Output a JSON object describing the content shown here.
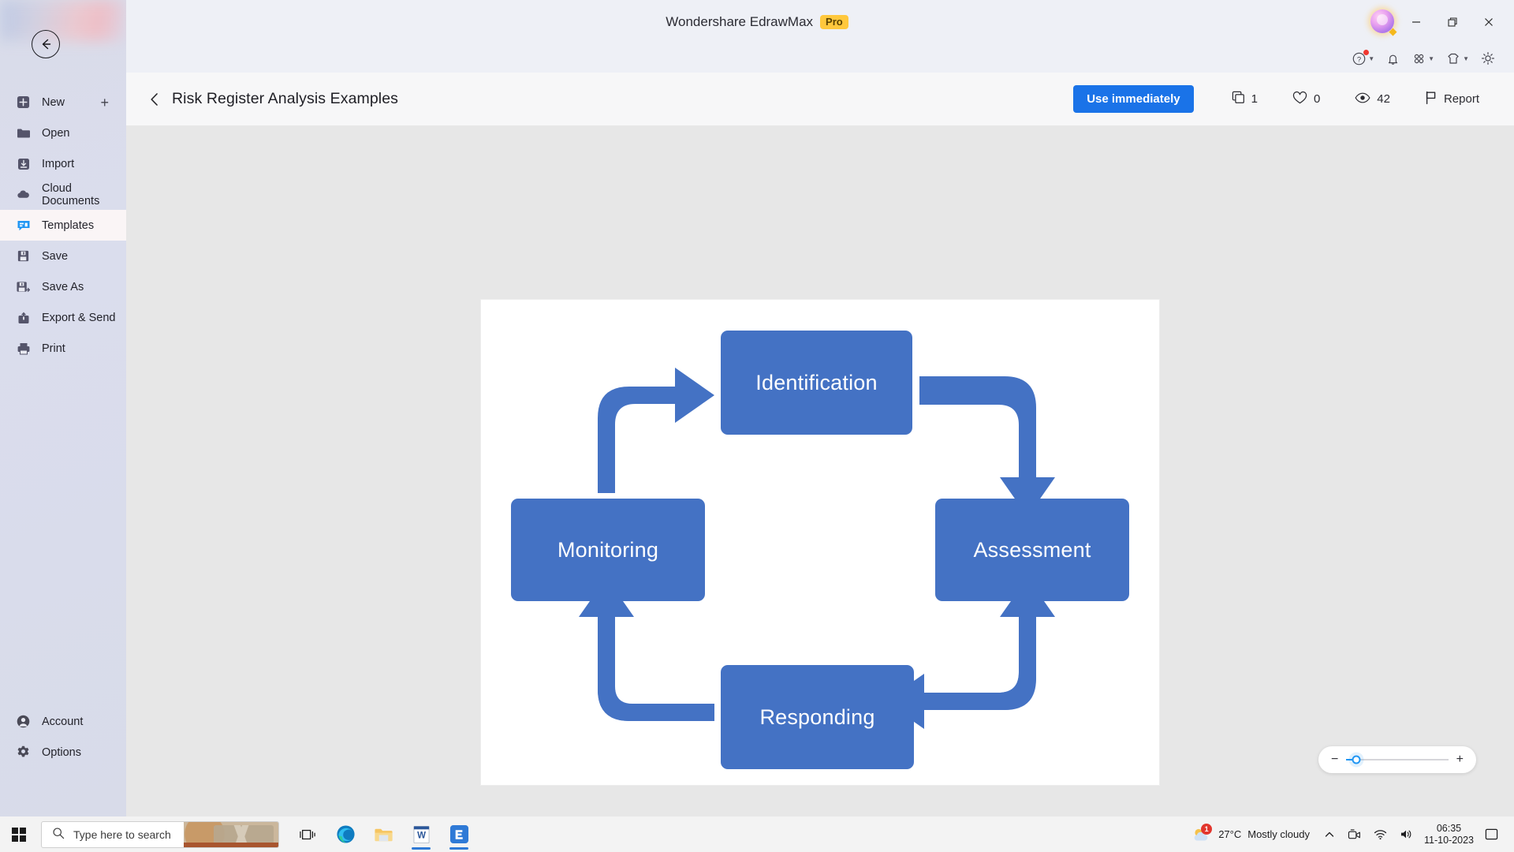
{
  "titlebar": {
    "app_title": "Wondershare EdrawMax",
    "pro_badge": "Pro",
    "minimize_label": "Minimize",
    "maximize_label": "Restore",
    "close_label": "Close",
    "avatar_name": "user-avatar"
  },
  "iconrow": {
    "items": [
      {
        "name": "help-icon",
        "label": "Help",
        "has_dot": true,
        "has_chevron": true
      },
      {
        "name": "bell-icon",
        "label": "Notifications",
        "has_dot": false,
        "has_chevron": false
      },
      {
        "name": "apps-grid-icon",
        "label": "Apps",
        "has_dot": false,
        "has_chevron": true
      },
      {
        "name": "theme-shirt-icon",
        "label": "Theme",
        "has_dot": false,
        "has_chevron": true
      },
      {
        "name": "gear-icon",
        "label": "Settings",
        "has_dot": false,
        "has_chevron": false
      }
    ]
  },
  "sidebar": {
    "back_label": "Back",
    "new_plus_label": "+",
    "items": [
      {
        "label": "New",
        "icon": "new-icon",
        "active": false,
        "has_plus": true
      },
      {
        "label": "Open",
        "icon": "folder-icon",
        "active": false,
        "has_plus": false
      },
      {
        "label": "Import",
        "icon": "import-icon",
        "active": false,
        "has_plus": false
      },
      {
        "label": "Cloud Documents",
        "icon": "cloud-icon",
        "active": false,
        "has_plus": false
      },
      {
        "label": "Templates",
        "icon": "templates-icon",
        "active": true,
        "has_plus": false
      },
      {
        "label": "Save",
        "icon": "save-icon",
        "active": false,
        "has_plus": false
      },
      {
        "label": "Save As",
        "icon": "save-as-icon",
        "active": false,
        "has_plus": false
      },
      {
        "label": "Export & Send",
        "icon": "export-icon",
        "active": false,
        "has_plus": false
      },
      {
        "label": "Print",
        "icon": "print-icon",
        "active": false,
        "has_plus": false
      }
    ],
    "bottom_items": [
      {
        "label": "Account",
        "icon": "account-icon"
      },
      {
        "label": "Options",
        "icon": "options-gear-icon"
      }
    ]
  },
  "docbar": {
    "back_label": "Back",
    "title": "Risk Register Analysis Examples",
    "use_button": "Use immediately",
    "stats": [
      {
        "name": "copies",
        "icon": "copy-icon",
        "value": "1"
      },
      {
        "name": "likes",
        "icon": "heart-icon",
        "value": "0"
      },
      {
        "name": "views",
        "icon": "eye-icon",
        "value": "42"
      }
    ],
    "report_label": "Report",
    "report_icon": "flag-icon"
  },
  "chart_data": {
    "type": "diagram",
    "subtype": "cycle-flow",
    "title": "Risk Register Analysis Examples",
    "node_color": "#4472C4",
    "node_text_color": "#ffffff",
    "arrow_color": "#4472C4",
    "canvas_background": "#ffffff",
    "nodes": [
      {
        "id": "identification",
        "label": "Identification",
        "position": "top"
      },
      {
        "id": "assessment",
        "label": "Assessment",
        "position": "right"
      },
      {
        "id": "responding",
        "label": "Responding",
        "position": "bottom"
      },
      {
        "id": "monitoring",
        "label": "Monitoring",
        "position": "left"
      }
    ],
    "edges": [
      {
        "from": "monitoring",
        "to": "identification",
        "shape": "elbow-up-right"
      },
      {
        "from": "identification",
        "to": "assessment",
        "shape": "elbow-right-down"
      },
      {
        "from": "assessment",
        "to": "responding",
        "shape": "elbow-down-left"
      },
      {
        "from": "responding",
        "to": "monitoring",
        "shape": "elbow-left-up"
      }
    ]
  },
  "zoom": {
    "minus_label": "−",
    "plus_label": "+",
    "value_percent": 10
  },
  "taskbar": {
    "start_label": "Start",
    "search_placeholder": "Type here to search",
    "search_icon": "search-icon",
    "apps": [
      {
        "name": "task-view-icon",
        "label": "Task View",
        "active": false
      },
      {
        "name": "edge-icon",
        "label": "Microsoft Edge",
        "active": false
      },
      {
        "name": "file-explorer-icon",
        "label": "File Explorer",
        "active": false
      },
      {
        "name": "word-icon",
        "label": "Microsoft Word",
        "active": true
      },
      {
        "name": "edrawmax-icon",
        "label": "Wondershare EdrawMax",
        "active": true
      }
    ],
    "tray": {
      "weather_temp": "27°C",
      "weather_desc": "Mostly cloudy",
      "weather_badge": "1",
      "chevron_label": "Show hidden icons",
      "icons": [
        {
          "name": "meet-now-camera-icon",
          "label": "Meet Now"
        },
        {
          "name": "wifi-icon",
          "label": "Network"
        },
        {
          "name": "volume-icon",
          "label": "Volume"
        }
      ],
      "time": "06:35",
      "date": "11-10-2023",
      "notification_icon": "notification-center-icon"
    }
  }
}
